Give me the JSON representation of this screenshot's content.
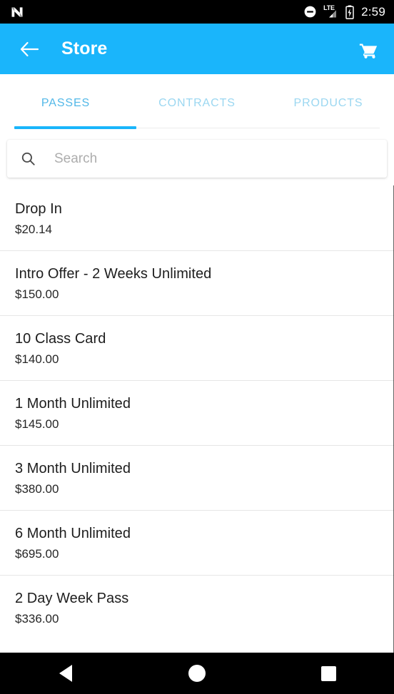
{
  "status_bar": {
    "logo_icon": "android-n-logo-icon",
    "dnd_icon": "do-not-disturb-icon",
    "network_label": "LTE",
    "signal_icon": "signal-bars-icon",
    "battery_icon": "battery-charging-icon",
    "time": "2:59"
  },
  "app_bar": {
    "back_icon": "back-arrow-icon",
    "title": "Store",
    "cart_icon": "shopping-cart-icon",
    "background_color": "#1AB5FB"
  },
  "tabs": {
    "items": [
      {
        "label": "PASSES",
        "active": true
      },
      {
        "label": "CONTRACTS",
        "active": false
      },
      {
        "label": "PRODUCTS",
        "active": false
      }
    ],
    "active_color": "#52B8E8",
    "inactive_color": "#9BD7F1",
    "indicator_color": "#1AB5FB"
  },
  "search": {
    "icon": "search-icon",
    "placeholder": "Search",
    "value": ""
  },
  "list": {
    "items": [
      {
        "name": "Drop In",
        "price": "$20.14"
      },
      {
        "name": "Intro Offer - 2 Weeks Unlimited",
        "price": "$150.00"
      },
      {
        "name": "10 Class Card",
        "price": "$140.00"
      },
      {
        "name": "1 Month Unlimited",
        "price": "$145.00"
      },
      {
        "name": "3 Month Unlimited",
        "price": "$380.00"
      },
      {
        "name": "6 Month Unlimited",
        "price": "$695.00"
      },
      {
        "name": "2 Day Week Pass",
        "price": "$336.00"
      }
    ]
  },
  "nav_bar": {
    "back_icon": "nav-back-triangle-icon",
    "home_icon": "nav-home-circle-icon",
    "recents_icon": "nav-recents-square-icon"
  }
}
